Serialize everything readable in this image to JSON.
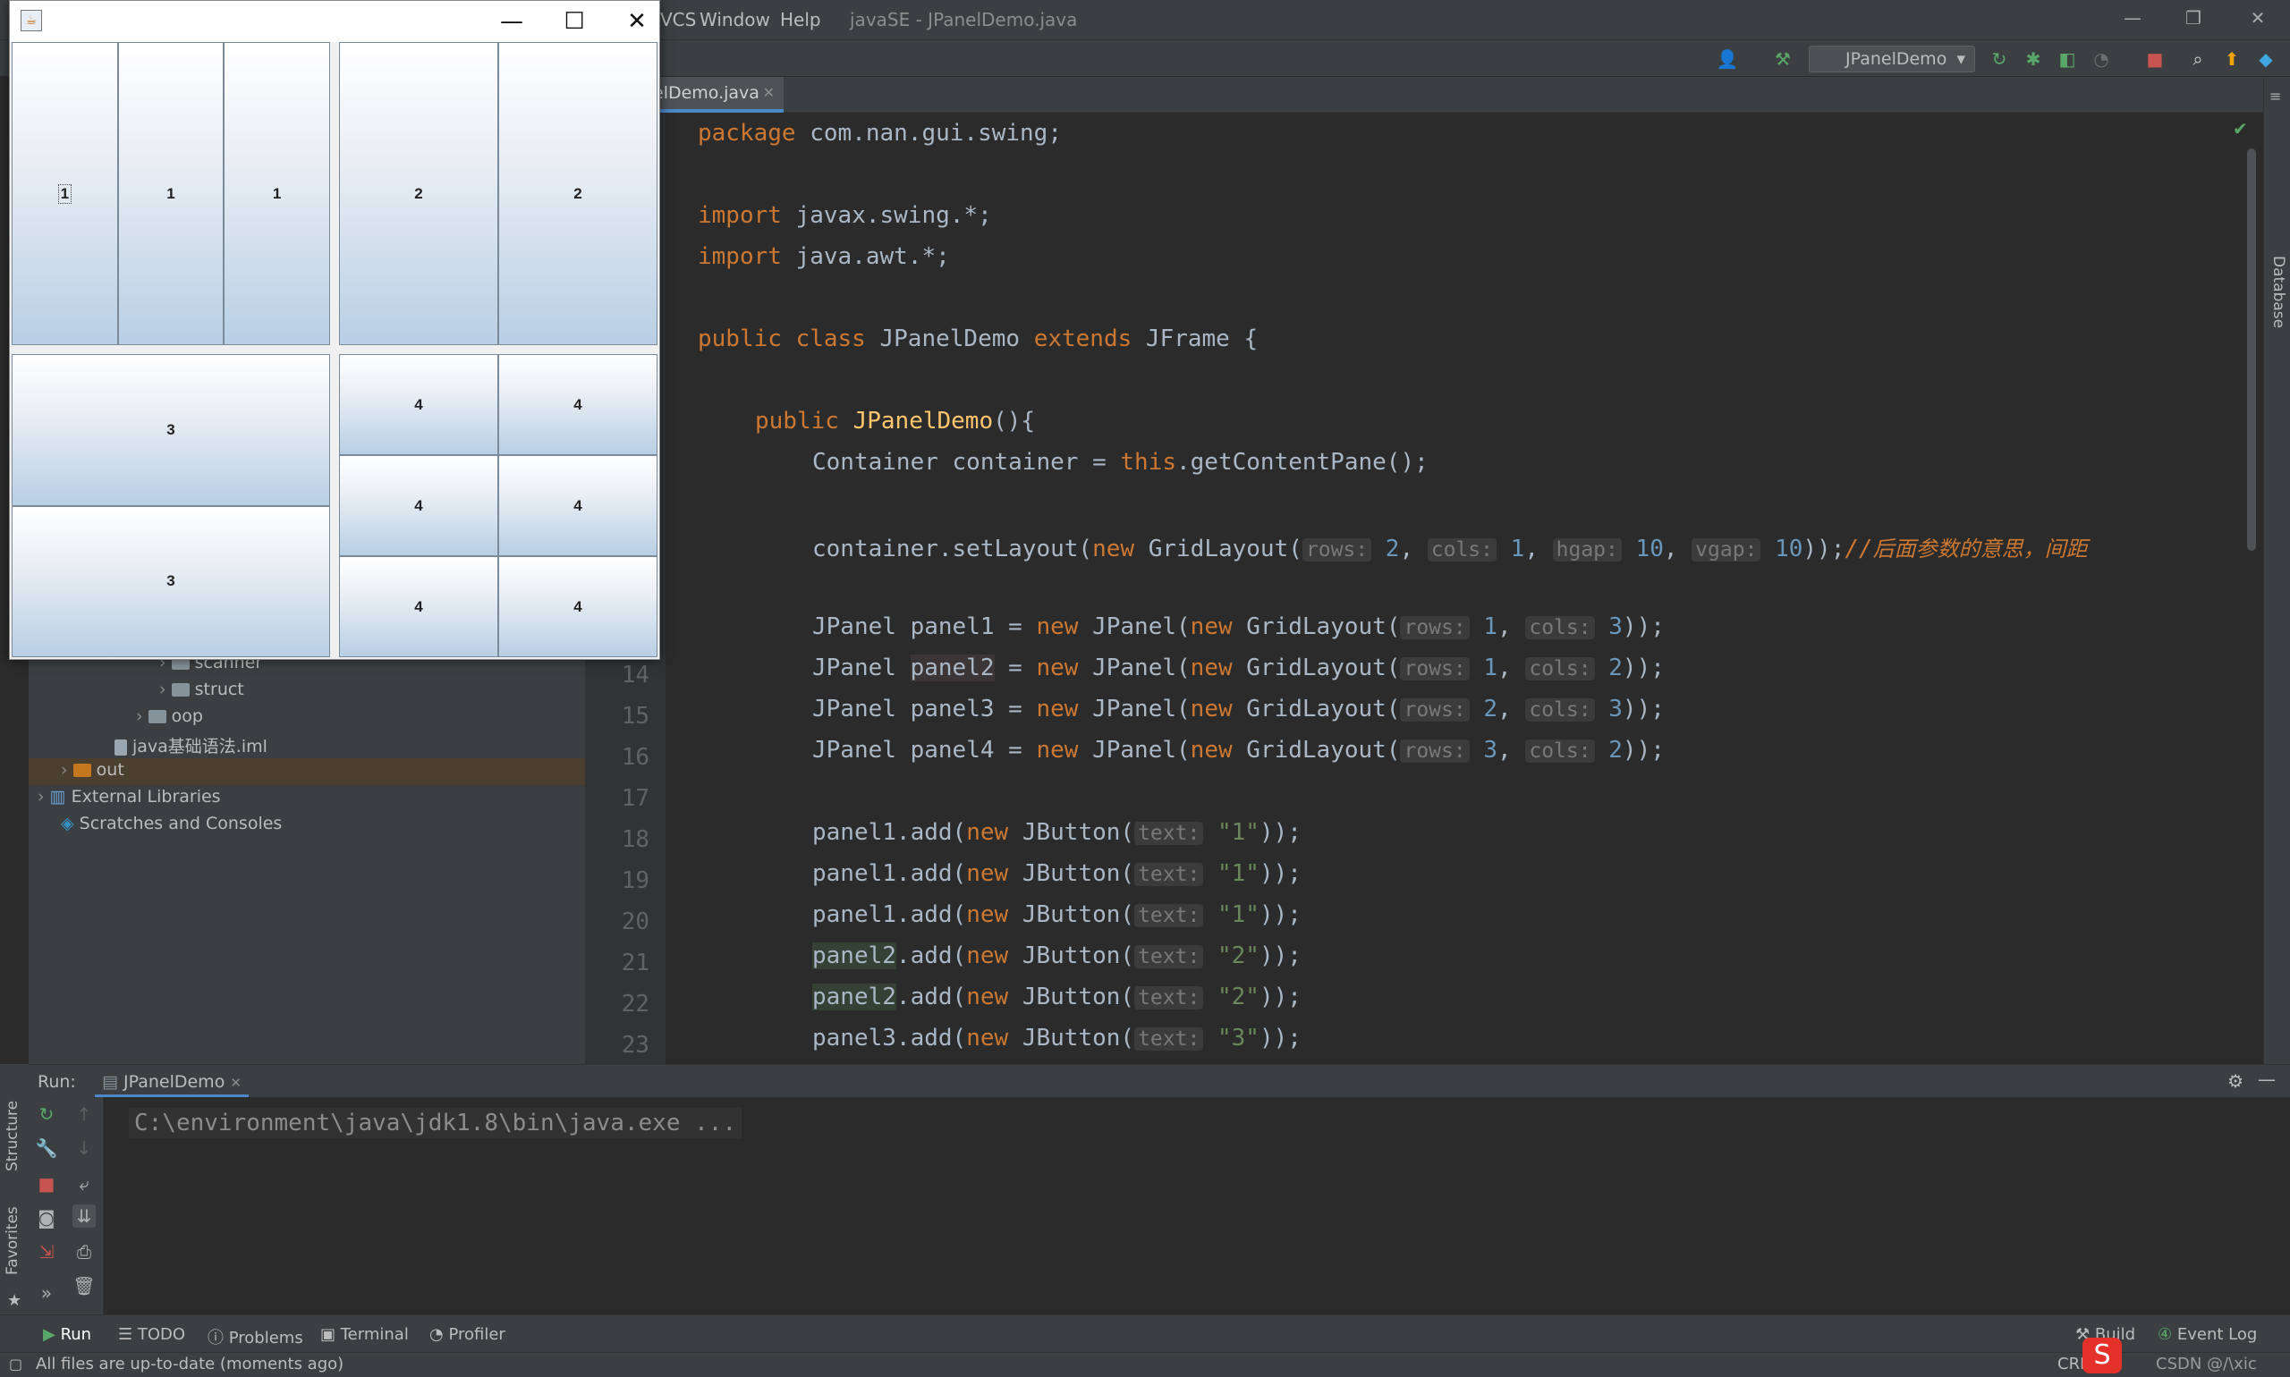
{
  "ide": {
    "menu_vcs": "VCS",
    "menu_window": "Window",
    "menu_help": "Help",
    "window_title": "javaSE - JPanelDemo.java",
    "run_config": "JPanelDemo",
    "file_tab": "JPanelDemo.java",
    "file_tab_visible": "elDemo.java",
    "right_strip_label": "Database"
  },
  "project_tree": {
    "items": [
      {
        "label": "scanner",
        "type": "package"
      },
      {
        "label": "struct",
        "type": "package"
      },
      {
        "label": "oop",
        "type": "folder"
      },
      {
        "label": "java基础语法.iml",
        "type": "file"
      },
      {
        "label": "out",
        "type": "folder-orange"
      },
      {
        "label": "External Libraries",
        "type": "library"
      },
      {
        "label": "Scratches and Consoles",
        "type": "scratch"
      }
    ]
  },
  "editor": {
    "line_numbers": [
      "14",
      "15",
      "16",
      "17",
      "18",
      "19",
      "20",
      "21",
      "22",
      "23"
    ],
    "code": {
      "l1_kw": "package",
      "l1_rest": " com.nan.gui.swing;",
      "l3_kw": "import",
      "l3_rest": " javax.swing.*;",
      "l4_kw": "import",
      "l4_rest": " java.awt.*;",
      "l6_kw1": "public class",
      "l6_name": " JPanelDemo ",
      "l6_kw2": "extends",
      "l6_rest": " JFrame {",
      "l8_kw": "public",
      "l8_fn": "JPanelDemo",
      "l8_rest": "(){",
      "l9_a": "Container container = ",
      "l9_kw": "this",
      "l9_b": ".getContentPane();",
      "l11_a": "container.setLayout(",
      "l11_kw": "new",
      "l11_b": " GridLayout(",
      "hint_rows": "rows:",
      "hint_cols": "cols:",
      "hint_hgap": "hgap:",
      "hint_vgap": "vgap:",
      "hint_text": "text:",
      "l11_rows": "2",
      "l11_cols": "1",
      "l11_hgap": "10",
      "l11_vgap": "10",
      "l11_end": "));",
      "l11_comment_slashes": "//",
      "l11_comment": "后面参数的意思，间距",
      "panel_decls": [
        {
          "name": "panel1",
          "rows": "1",
          "cols": "3"
        },
        {
          "name": "panel2",
          "rows": "1",
          "cols": "2"
        },
        {
          "name": "panel3",
          "rows": "2",
          "cols": "3"
        },
        {
          "name": "panel4",
          "rows": "3",
          "cols": "2"
        }
      ],
      "decl_a": "JPanel ",
      "decl_eq": " = ",
      "decl_new": "new",
      "decl_jpanel": " JPanel(",
      "decl_grid": " GridLayout(",
      "decl_end": "));",
      "adds": [
        {
          "panel": "panel1",
          "text": "\"1\""
        },
        {
          "panel": "panel1",
          "text": "\"1\""
        },
        {
          "panel": "panel1",
          "text": "\"1\""
        },
        {
          "panel": "panel2",
          "text": "\"2\""
        },
        {
          "panel": "panel2",
          "text": "\"2\""
        },
        {
          "panel": "panel3",
          "text": "\"3\""
        }
      ],
      "add_mid": ".add(",
      "add_jbutton": " JButton(",
      "add_end": "));"
    }
  },
  "run_panel": {
    "label": "Run:",
    "tab": "JPanelDemo",
    "console_line": "C:\\environment\\java\\jdk1.8\\bin\\java.exe ..."
  },
  "left_strip": {
    "structure": "Structure",
    "favorites": "Favorites"
  },
  "bottom_tabs": {
    "run": "Run",
    "todo": "TODO",
    "problems": "Problems",
    "terminal": "Terminal",
    "profiler": "Profiler",
    "build": "Build",
    "event_log": "Event Log"
  },
  "status": {
    "message": "All files are up-to-date (moments ago)",
    "line_sep": "CRLF",
    "watermark": "CSDN @/\\xic"
  },
  "swing_window": {
    "buttons": {
      "panel1": [
        "1",
        "1",
        "1"
      ],
      "panel2": [
        "2",
        "2"
      ],
      "panel3": [
        "3",
        "3"
      ],
      "panel4": [
        "4",
        "4",
        "4",
        "4",
        "4",
        "4"
      ]
    }
  },
  "colors": {
    "keyword": "#cc7832",
    "number": "#6897bb",
    "string": "#6a8759",
    "function": "#ffc66d",
    "editor_bg": "#2b2b2b",
    "panel_bg": "#3c3f41"
  }
}
